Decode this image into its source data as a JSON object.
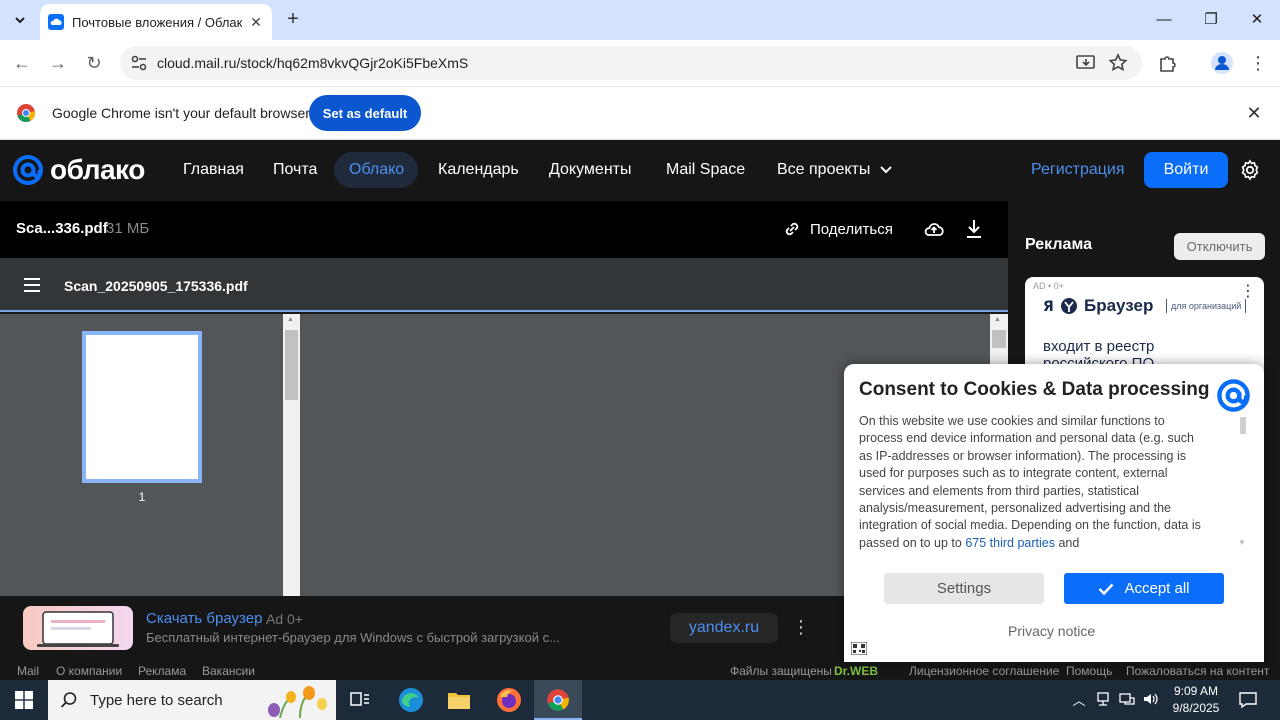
{
  "browser": {
    "tab_title": "Почтовые вложения / Облако",
    "url": "cloud.mail.ru/stock/hq62m8vkvQGjr2oKi5FbeXmS"
  },
  "infobar": {
    "message": "Google Chrome isn't your default browser",
    "button": "Set as default"
  },
  "header": {
    "logo": "облако",
    "nav": [
      "Главная",
      "Почта",
      "Облако",
      "Календарь",
      "Документы",
      "Mail Space",
      "Все проекты"
    ],
    "registration": "Регистрация",
    "login": "Войти"
  },
  "file": {
    "short_name": "Sca...336.pdf",
    "size": "31 МБ",
    "share": "Поделиться",
    "pdf_title": "Scan_20250905_175336.pdf",
    "page_number": "1"
  },
  "sidebar": {
    "heading": "Реклама",
    "disable": "Отключить",
    "card_tag": "AD • 0+",
    "card_brand": "Браузер",
    "card_org": "для организаций",
    "card_line1": "входит в реестр",
    "card_line2": "российского ПО"
  },
  "consent": {
    "title": "Consent to Cookies & Data processing",
    "body": "On this website we use cookies and similar functions to process end device information and personal data (e.g. such as IP-addresses or browser information). The processing is used for purposes such as to integrate content, external services and elements from third parties, statistical analysis/measurement, personalized advertising and the integration of social media. Depending on the function, data is passed on to up to ",
    "link": "675 third parties",
    "body_tail": " and",
    "settings": "Settings",
    "accept": "Accept all",
    "privacy": "Privacy notice"
  },
  "banner": {
    "title": "Скачать браузер",
    "age": "Ad 0+",
    "description": "Бесплатный интернет-браузер для Windows с быстрой загрузкой с...",
    "domain": "yandex.ru"
  },
  "footer": {
    "left": [
      "Mail",
      "О компании",
      "Реклама",
      "Вакансии"
    ],
    "protected": "Файлы защищены",
    "drweb": "Dr.WEB",
    "right": [
      "Лицензионное соглашение",
      "Помощь",
      "Пожаловаться на контент"
    ]
  },
  "taskbar": {
    "search_placeholder": "Type here to search",
    "time": "9:09 AM",
    "date": "9/8/2025"
  },
  "colors": {
    "accent": "#0a6efa",
    "chrome_blue": "#0b57d0",
    "link_blue": "#4d8fef"
  }
}
